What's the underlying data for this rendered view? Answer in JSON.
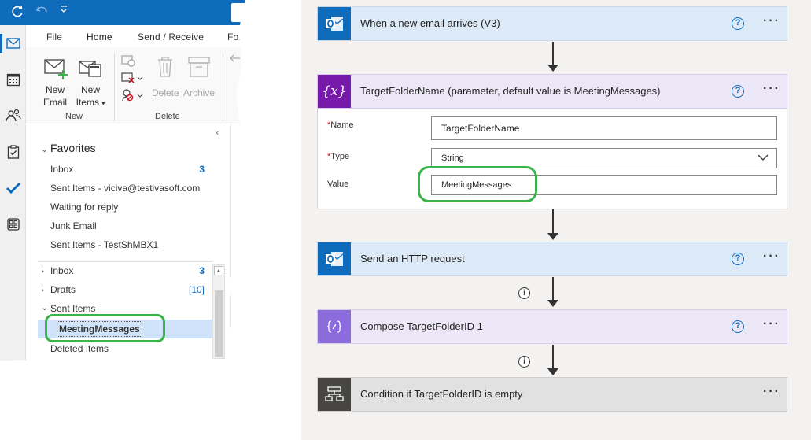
{
  "outlook": {
    "ribbon_tabs": [
      "File",
      "Home",
      "Send / Receive",
      "Fold"
    ],
    "ribbon": {
      "new_email": "New\nEmail",
      "new_email_l1": "New",
      "new_email_l2": "Email",
      "new_items_l1": "New",
      "new_items_l2": "Items",
      "delete": "Delete",
      "archive": "Archive",
      "group_new": "New",
      "group_delete": "Delete"
    },
    "favorites": {
      "title": "Favorites",
      "items": [
        {
          "label": "Inbox",
          "count": "3"
        },
        {
          "label": "Sent Items - viciva@testivasoft.com",
          "count": ""
        },
        {
          "label": "Waiting for reply",
          "count": ""
        },
        {
          "label": "Junk Email",
          "count": ""
        },
        {
          "label": "Sent Items - TestShMBX1",
          "count": ""
        }
      ]
    },
    "folders": [
      {
        "label": "Inbox",
        "count": "3"
      },
      {
        "label": "Drafts",
        "count": "[10]"
      },
      {
        "label": "Sent Items",
        "count": ""
      },
      {
        "label": "MeetingMessages",
        "count": ""
      },
      {
        "label": "Deleted Items",
        "count": ""
      }
    ]
  },
  "flow": {
    "trigger": {
      "title": "When a new email arrives (V3)"
    },
    "variable": {
      "title": "TargetFolderName (parameter, default value is MeetingMessages)",
      "icon_text": "{x}",
      "name_label": "Name",
      "name_value": "TargetFolderName",
      "type_label": "Type",
      "type_value": "String",
      "value_label": "Value",
      "value_value": "MeetingMessages"
    },
    "http": {
      "title": "Send an HTTP request"
    },
    "compose": {
      "title": "Compose TargetFolderID 1"
    },
    "condition": {
      "title": "Condition if TargetFolderID is empty"
    },
    "help_glyph": "?",
    "more_glyph": "···",
    "info_glyph": "i",
    "required_mark": "*"
  },
  "colors": {
    "outlook_blue": "#0f6cbd",
    "highlight_green": "#3bb34a",
    "selection": "#cfe4fa"
  }
}
